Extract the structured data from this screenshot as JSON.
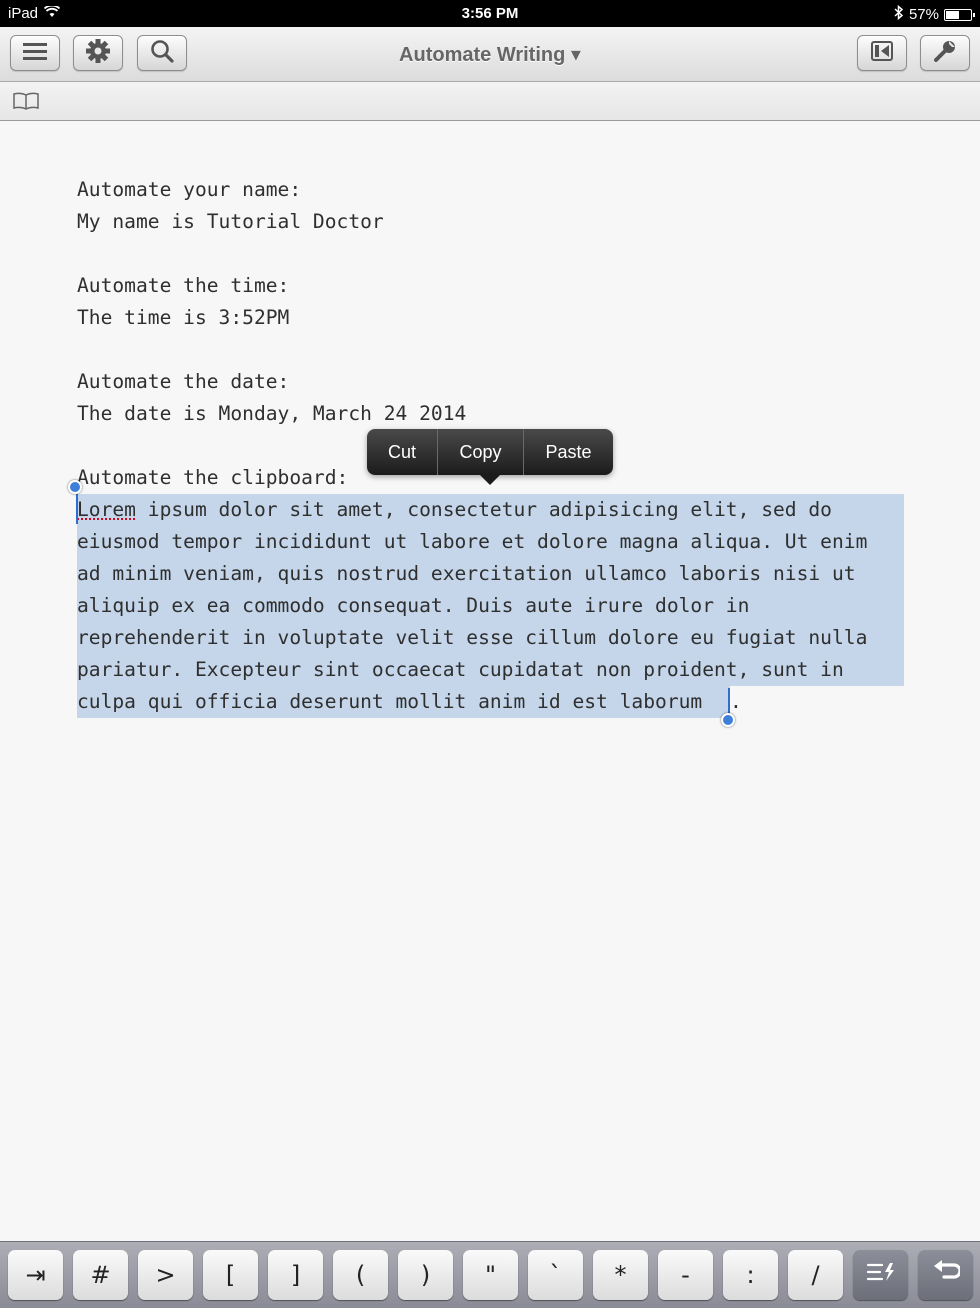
{
  "status_bar": {
    "device": "iPad",
    "time": "3:56 PM",
    "battery": "57%",
    "battery_level": 0.57
  },
  "toolbar": {
    "title": "Automate Writing ▾"
  },
  "editor": {
    "lines": [
      "Automate your name:",
      "My name is Tutorial Doctor",
      "",
      "Automate the time:",
      "The time is 3:52PM",
      "",
      "Automate the date:",
      "The date is Monday, March 24 2014",
      "",
      "Automate the clipboard:"
    ],
    "selected_first_word": "Lorem",
    "selected_lines": [
      " ipsum dolor sit amet, consectetur adipisicing elit, sed do",
      "eiusmod tempor incididunt ut labore et dolore magna aliqua. Ut enim",
      "ad minim veniam, quis nostrud exercitation ullamco laboris nisi ut",
      "aliquip ex ea commodo consequat. Duis aute irure dolor in",
      "reprehenderit in voluptate velit esse cillum dolore eu fugiat nulla",
      "pariatur. Excepteur sint occaecat cupidatat non proident, sunt in",
      "culpa qui officia deserunt mollit anim id est laborum"
    ],
    "after_selection": "."
  },
  "edit_menu": {
    "cut": "Cut",
    "copy": "Copy",
    "paste": "Paste"
  },
  "keybar": {
    "keys": [
      "⇥",
      "#",
      ">",
      "[",
      "]",
      "(",
      ")",
      "\"",
      "`",
      "*",
      "-",
      ":",
      "/"
    ]
  },
  "icons": {
    "menu": "menu-icon",
    "settings": "gear-icon",
    "search": "search-icon",
    "preview": "preview-icon",
    "tools": "wrench-icon",
    "book": "book-icon",
    "format": "format-icon",
    "undo": "undo-icon"
  }
}
